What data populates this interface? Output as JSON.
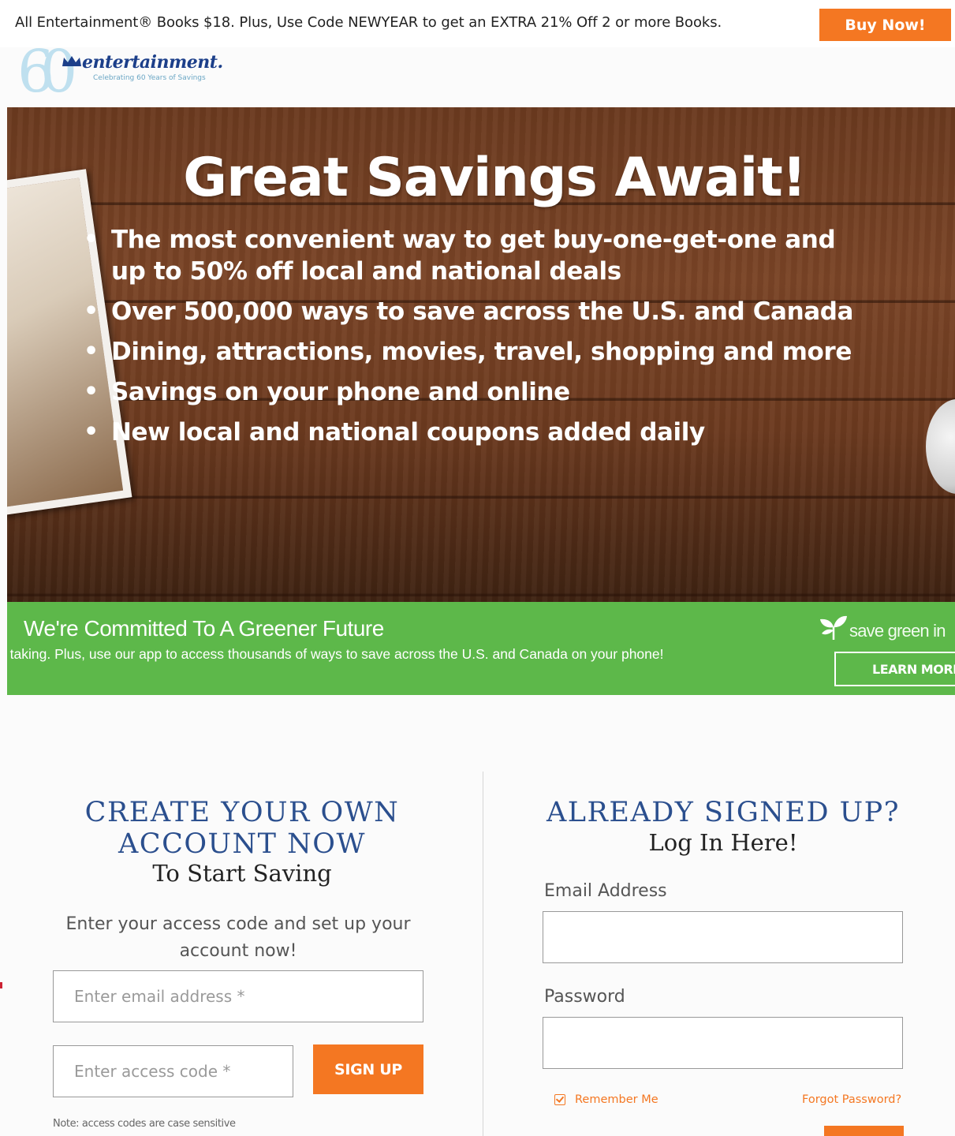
{
  "promo": {
    "text": "All Entertainment® Books $18. Plus, Use Code NEWYEAR to get an EXTRA 21% Off 2 or more Books.",
    "buy_label": "Buy Now!"
  },
  "logo": {
    "number": "60",
    "word": "entertainment.",
    "tagline": "Celebrating 60 Years of Savings"
  },
  "hero": {
    "title": "Great Savings Await!",
    "bullets": [
      "The most convenient way to get buy-one-get-one and up to 50% off local and national deals",
      "Over 500,000 ways to save across the U.S. and Canada",
      "Dining, attractions, movies, travel, shopping and more",
      "Savings on your phone and online",
      "New local and national coupons added daily"
    ]
  },
  "green": {
    "title": "We're Committed To A Greener Future",
    "text": "we're taking. Plus, use our app to access thousands of ways to save across the U.S. and Canada on your phone!",
    "save_green_label": "save green in",
    "learn_more_label": "LEARN MORE"
  },
  "signup": {
    "title": "CREATE YOUR OWN ACCOUNT NOW",
    "subtitle": "To Start Saving",
    "instructions": "Enter your access code and set up your account now!",
    "email_placeholder": "Enter email address *",
    "code_placeholder": "Enter access code *",
    "button_label": "SIGN UP",
    "note": "Note: access codes are case sensitive"
  },
  "login": {
    "title": "ALREADY SIGNED UP?",
    "subtitle": "Log In Here!",
    "email_label": "Email Address",
    "password_label": "Password",
    "remember_label": "Remember Me",
    "forgot_label": "Forgot Password?"
  },
  "colors": {
    "accent": "#f47722",
    "green": "#5db84a",
    "heading_blue": "#2b4f8e"
  }
}
